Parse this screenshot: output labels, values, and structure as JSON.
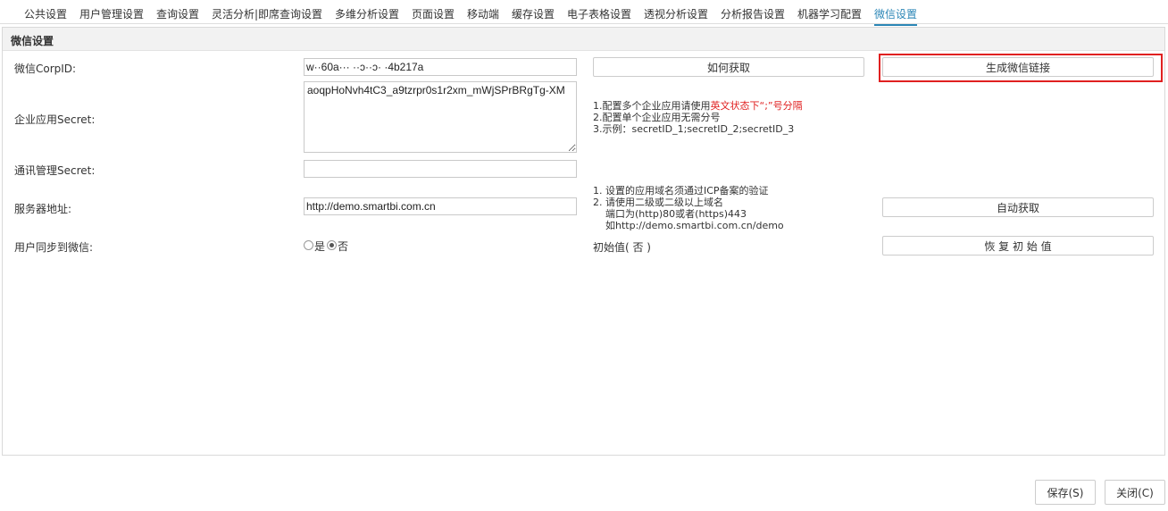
{
  "tabs": [
    {
      "label": "公共设置",
      "active": false
    },
    {
      "label": "用户管理设置",
      "active": false
    },
    {
      "label": "查询设置",
      "active": false
    },
    {
      "label": "灵活分析|即席查询设置",
      "active": false
    },
    {
      "label": "多维分析设置",
      "active": false
    },
    {
      "label": "页面设置",
      "active": false
    },
    {
      "label": "移动端",
      "active": false
    },
    {
      "label": "缓存设置",
      "active": false
    },
    {
      "label": "电子表格设置",
      "active": false
    },
    {
      "label": "透视分析设置",
      "active": false
    },
    {
      "label": "分析报告设置",
      "active": false
    },
    {
      "label": "机器学习配置",
      "active": false
    },
    {
      "label": "微信设置",
      "active": true
    }
  ],
  "panel": {
    "title": "微信设置"
  },
  "form": {
    "corpid": {
      "label": "微信CorpID:",
      "value": "w··60a··· ··ɔ··ɔ· ·4b217a",
      "how_to_get_button": "如何获取",
      "generate_link_button": "生成微信链接"
    },
    "app_secret": {
      "label": "企业应用Secret:",
      "value": "aoqpHoNvh4tC3_a9tzrpr0s1r2xm_mWjSPrBRgTg-XM",
      "note_line1_prefix": "1.配置多个企业应用请使用",
      "note_line1_red": "英文状态下“;”号分隔",
      "note_line2": "2.配置单个企业应用无需分号",
      "note_line3": "3.示例：secretID_1;secretID_2;secretID_3"
    },
    "contacts_secret": {
      "label": "通讯管理Secret:",
      "value": ""
    },
    "server_address": {
      "label": "服务器地址:",
      "value": "http://demo.smartbi.com.cn",
      "note_line1": "1. 设置的应用域名须通过ICP备案的验证",
      "note_line2": "2. 请使用二级或二级以上域名",
      "note_line3": "    端口为(http)80或者(https)443",
      "note_line4": "    如http://demo.smartbi.com.cn/demo",
      "auto_get_button": "自动获取"
    },
    "sync_users": {
      "label": "用户同步到微信:",
      "option_yes": "是",
      "option_no": "否",
      "selected": "否",
      "initial_value": "初始值( 否 )",
      "restore_button": "恢 复 初 始 值"
    }
  },
  "footer": {
    "save_button": "保存(S)",
    "close_button": "关闭(C)"
  }
}
